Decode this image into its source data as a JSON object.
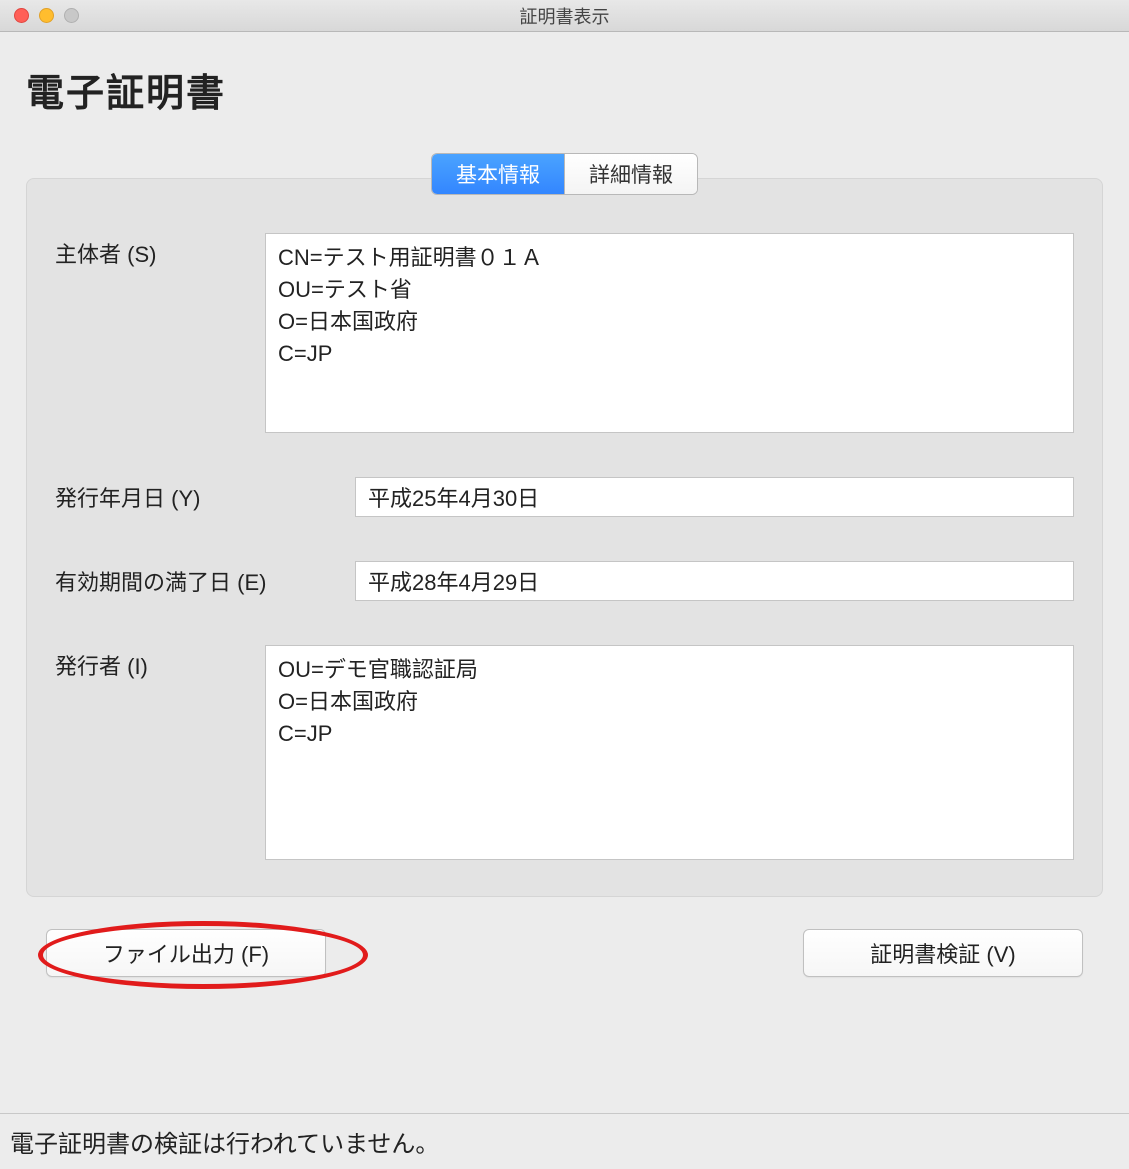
{
  "window": {
    "title": "証明書表示"
  },
  "heading": "電子証明書",
  "tabs": {
    "basic": "基本情報",
    "detail": "詳細情報"
  },
  "fields": {
    "subject": {
      "label": "主体者 (S)",
      "value": "CN=テスト用証明書０１Ａ\nOU=テスト省\nO=日本国政府\nC=JP"
    },
    "issued_date": {
      "label": "発行年月日 (Y)",
      "value": "平成25年4月30日"
    },
    "expiry_date": {
      "label": "有効期間の満了日 (E)",
      "value": "平成28年4月29日"
    },
    "issuer": {
      "label": "発行者 (I)",
      "value": "OU=デモ官職認証局\nO=日本国政府\nC=JP"
    }
  },
  "buttons": {
    "file_output": "ファイル出力 (F)",
    "verify": "証明書検証 (V)"
  },
  "status": "電子証明書の検証は行われていません。"
}
